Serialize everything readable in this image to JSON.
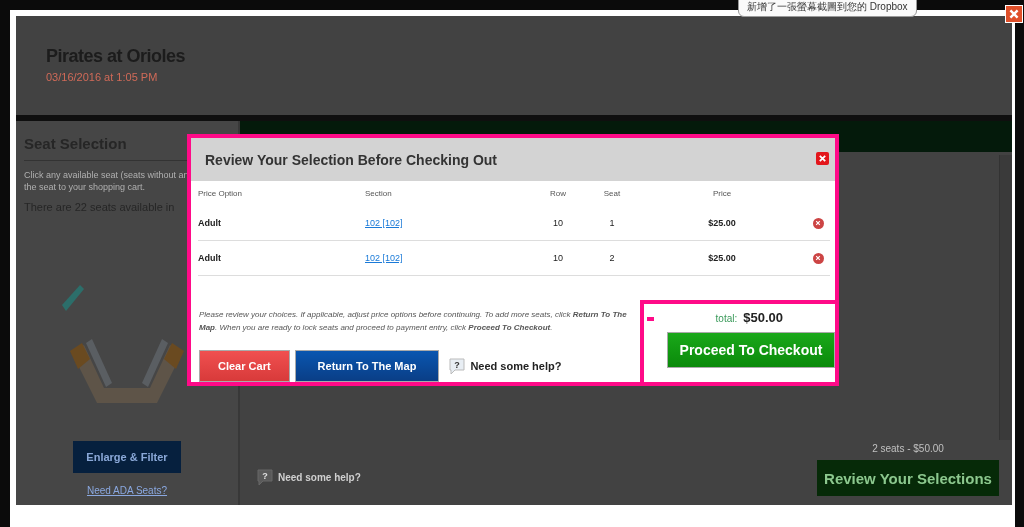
{
  "notification": {
    "text": "新增了一張螢幕截圖到您的 Dropbox"
  },
  "event": {
    "title": "Pirates at Orioles",
    "date": "03/16/2016 at 1:05 PM"
  },
  "seat_panel": {
    "heading": "Seat Selection",
    "instructions": [
      "Click any available seat (seats without an",
      "the seat to your shopping cart."
    ],
    "availability": "There are 22 seats available in",
    "button": "Enlarge & Filter",
    "link": "Need ADA Seats?"
  },
  "main_panel": {
    "help_icon": "?",
    "help": "Need some help?",
    "summary": "2 seats - $50.00",
    "button": "Review Your Selections"
  },
  "modal": {
    "title": "Review Your Selection Before Checking Out",
    "columns": [
      "Price Option",
      "Section",
      "Row",
      "Seat",
      "Price"
    ],
    "rows": [
      {
        "price_option": "Adult",
        "section": "102 [102]",
        "row": "10",
        "seat": "1",
        "price": "$25.00"
      },
      {
        "price_option": "Adult",
        "section": "102 [102]",
        "row": "10",
        "seat": "2",
        "price": "$25.00"
      }
    ],
    "note": "Please review your choices. If applicable, adjust price options before continuing. To add more seats, click **Return To The Map**. When you are ready to lock seats and proceed to payment entry, click **Proceed To Checkout**.",
    "buttons": [
      {
        "kind": "danger",
        "label": "Clear Cart"
      },
      {
        "kind": "primary",
        "label": "Return To The Map"
      }
    ],
    "help_icon": "?",
    "help": "Need some help?",
    "total_label": "total:",
    "total": "$50.00",
    "checkout": "Proceed To Checkout"
  }
}
